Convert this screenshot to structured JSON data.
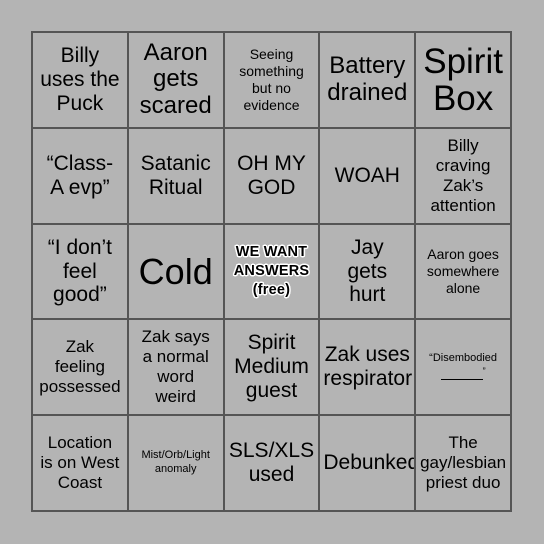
{
  "card": {
    "title": "Bingo Card",
    "background_color": "#b4b4b4",
    "border_color": "#555555",
    "text_color": "#000000",
    "rows": 5,
    "columns": 5,
    "cells": [
      {
        "text": "Billy\nuses the\nPuck",
        "size": "s-md",
        "free": false
      },
      {
        "text": "Aaron\ngets\nscared",
        "size": "s-lg",
        "free": false
      },
      {
        "text": "Seeing\nsomething\nbut no\nevidence",
        "size": "s-xs",
        "free": false
      },
      {
        "text": "Battery\ndrained",
        "size": "s-lg",
        "free": false
      },
      {
        "text": "Spirit\nBox",
        "size": "s-xxl",
        "free": false
      },
      {
        "text": "“Class-\nA evp”",
        "size": "s-md",
        "free": false
      },
      {
        "text": "Satanic\nRitual",
        "size": "s-md",
        "free": false
      },
      {
        "text": "OH MY\nGOD",
        "size": "s-md",
        "free": false
      },
      {
        "text": "WOAH",
        "size": "s-md",
        "free": false
      },
      {
        "text": "Billy\ncraving\nZak’s\nattention",
        "size": "s-sm",
        "free": false
      },
      {
        "text": "“I don’t\nfeel\ngood”",
        "size": "s-md",
        "free": false
      },
      {
        "text": "Cold",
        "size": "s-xl",
        "free": false
      },
      {
        "text": "WE WANT\nANSWERS\n(free)",
        "size": "free",
        "free": true
      },
      {
        "text": "Jay\ngets\nhurt",
        "size": "s-md",
        "free": false
      },
      {
        "text": "Aaron goes\nsomewhere\nalone",
        "size": "s-xs",
        "free": false
      },
      {
        "text": "Zak\nfeeling\npossessed",
        "size": "s-sm",
        "free": false
      },
      {
        "text": "Zak says\na normal\nword\nweird",
        "size": "s-sm",
        "free": false
      },
      {
        "text": "Spirit\nMedium\nguest",
        "size": "s-md",
        "free": false
      },
      {
        "text": "Zak uses\nrespirator",
        "size": "s-md",
        "free": false
      },
      {
        "text": "“Disembodied\n_____”",
        "size": "blankline",
        "free": false
      },
      {
        "text": "Location\nis on West\nCoast",
        "size": "s-sm",
        "free": false
      },
      {
        "text": "Mist/Orb/Light\nanomaly",
        "size": "s-xxs",
        "free": false
      },
      {
        "text": "SLS/XLS\nused",
        "size": "s-md",
        "free": false
      },
      {
        "text": "Debunked",
        "size": "s-md",
        "free": false
      },
      {
        "text": "The\ngay/lesbian\npriest duo",
        "size": "s-sm",
        "free": false
      }
    ]
  }
}
